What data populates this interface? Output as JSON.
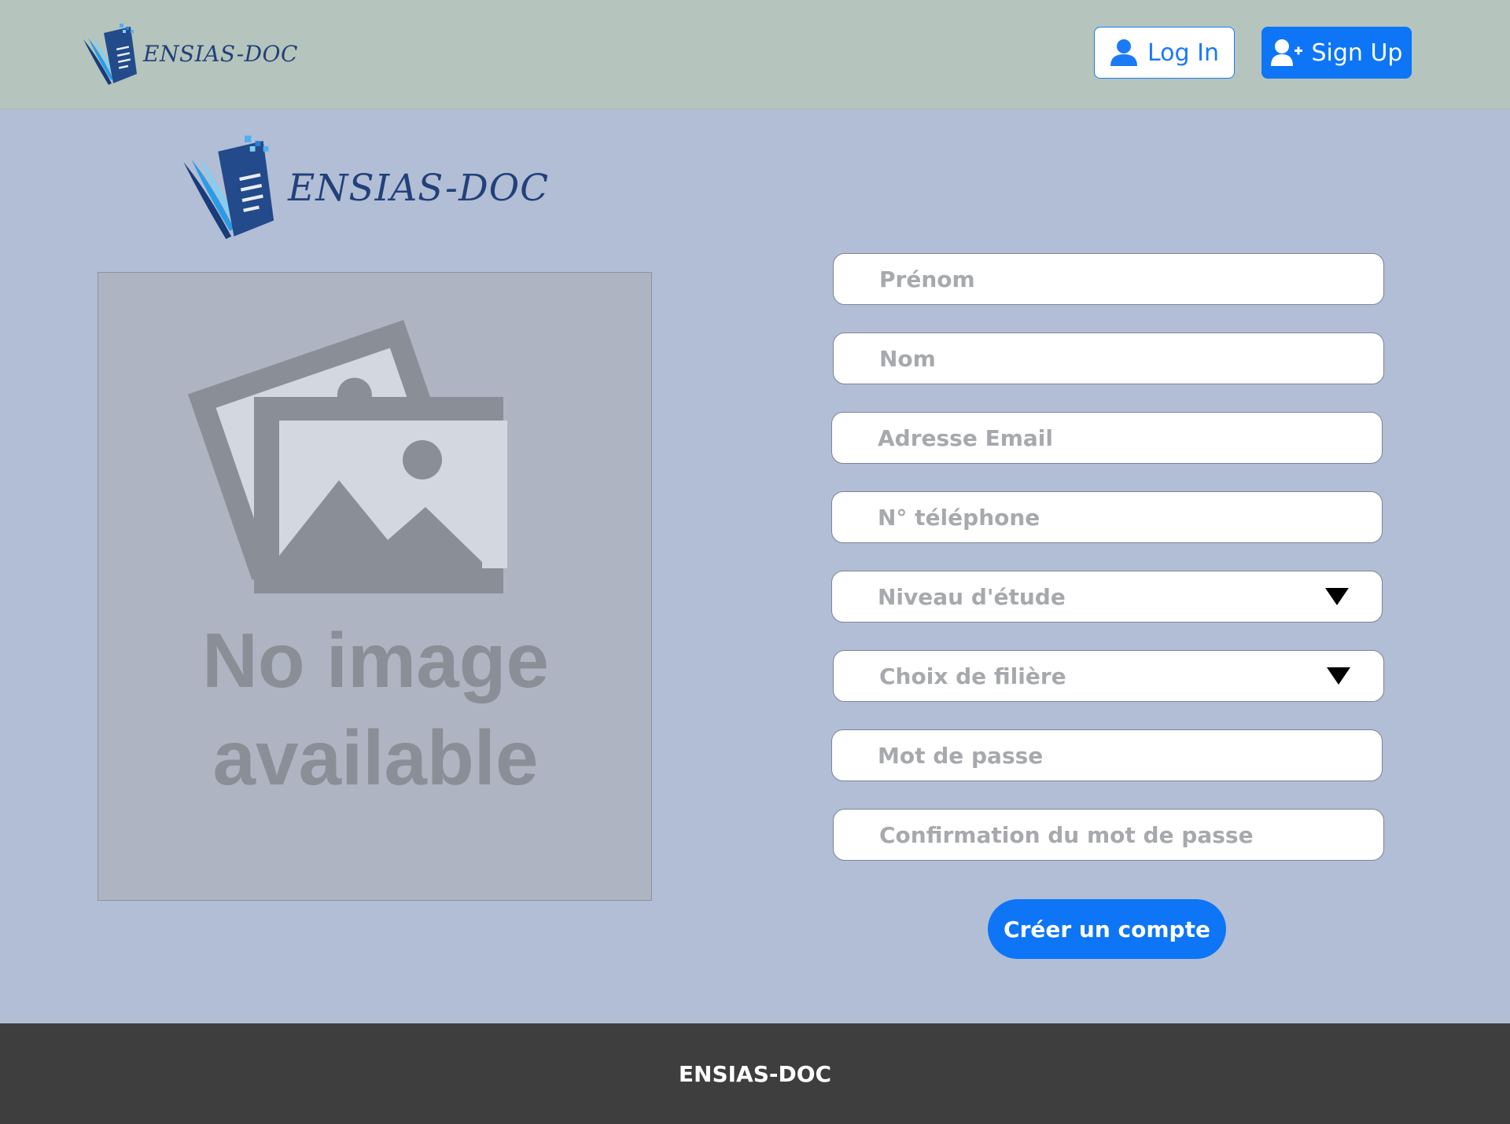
{
  "header": {
    "logo_text": "ENSIAS-DOC",
    "login_label": "Log In",
    "signup_label": "Sign Up"
  },
  "main": {
    "logo_text": "ENSIAS-DOC",
    "image_placeholder": {
      "line1": "No image",
      "line2": "available"
    }
  },
  "form": {
    "first_name_placeholder": "Prénom",
    "last_name_placeholder": "Nom",
    "email_placeholder": "Adresse Email",
    "phone_placeholder": "N° téléphone",
    "study_level_label": "Niveau d'étude",
    "major_label": "Choix de filière",
    "password_placeholder": "Mot de passe",
    "password_confirm_placeholder": "Confirmation du mot de passe",
    "submit_label": "Créer un compte"
  },
  "footer": {
    "text": "ENSIAS-DOC"
  },
  "icons": {
    "login": "user-icon",
    "signup": "user-plus-icon",
    "select_arrow": "caret-down-icon",
    "logo": "document-logo-icon",
    "placeholder": "image-placeholder-icon"
  },
  "colors": {
    "header_bg": "#b5c4bc",
    "page_bg": "#b1bed5",
    "primary": "#0d75f6",
    "footer_bg": "#3e3e3e",
    "logo_navy": "#23407a"
  }
}
